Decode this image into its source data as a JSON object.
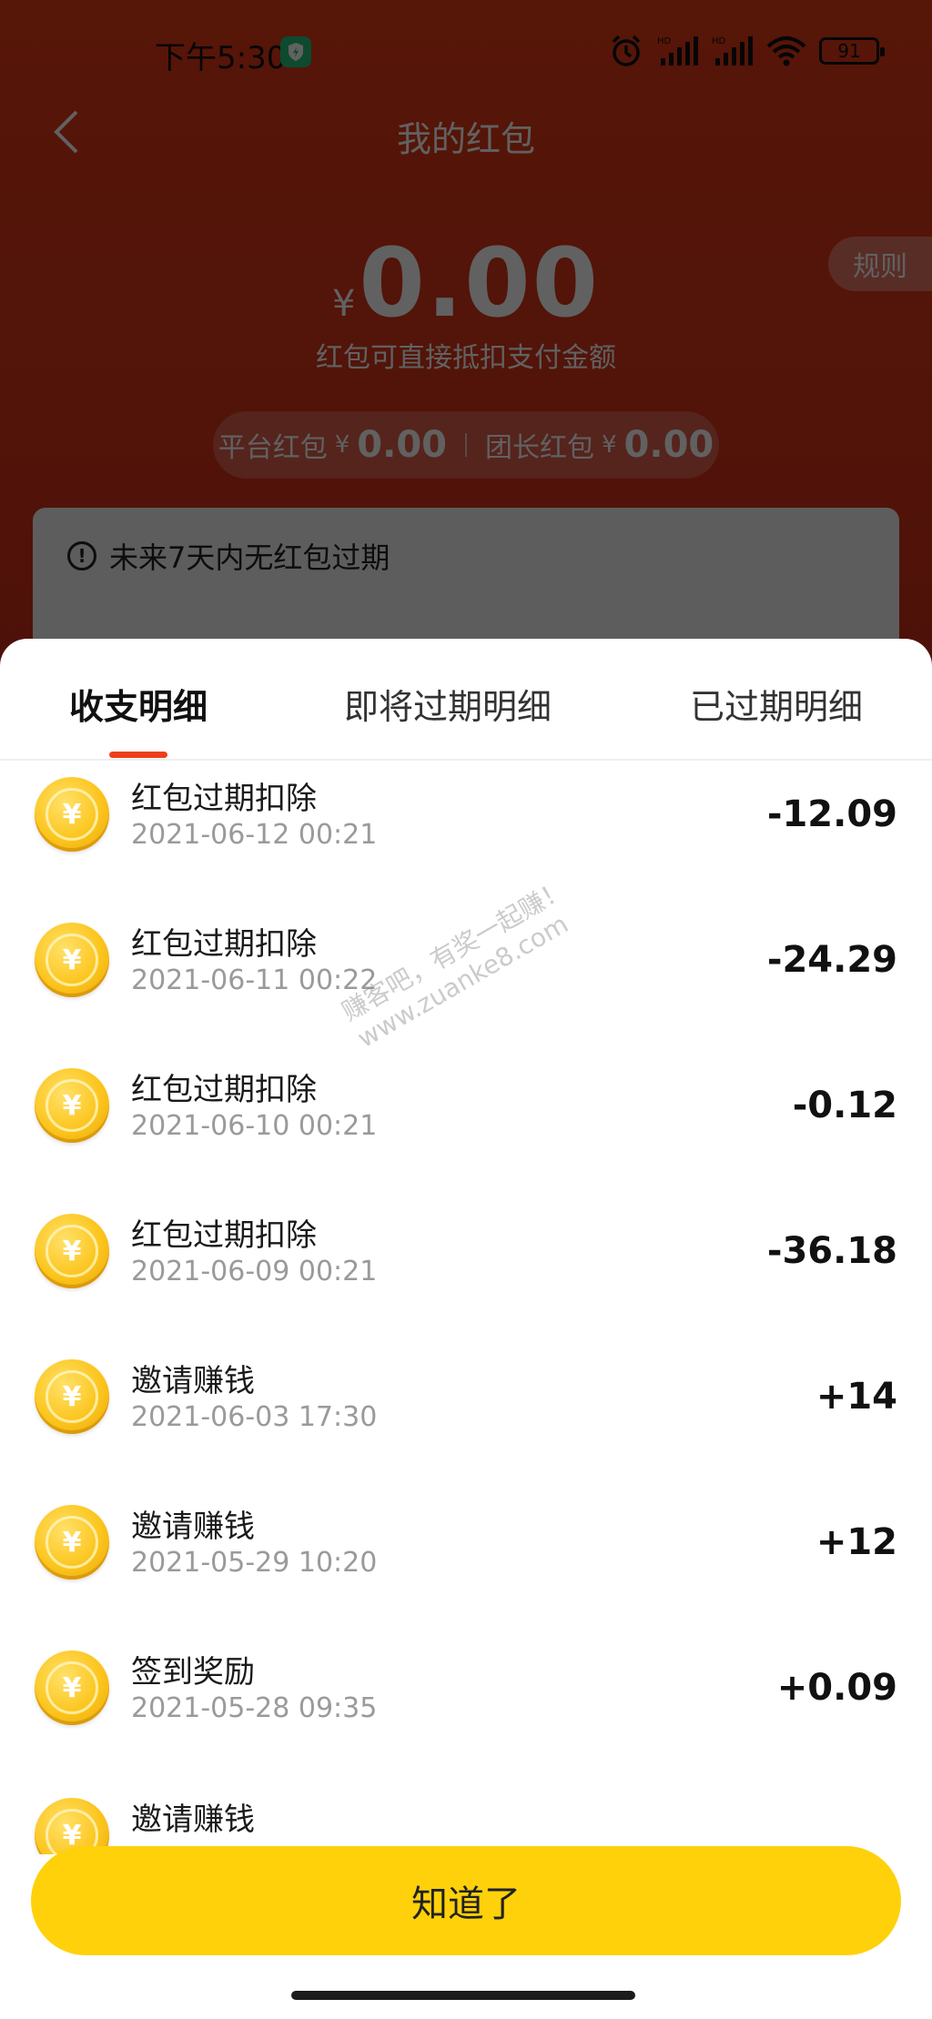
{
  "status_bar": {
    "time": "下午5:30",
    "battery": "91"
  },
  "header": {
    "title": "我的红包",
    "rules_label": "规则"
  },
  "balance": {
    "currency": "¥",
    "amount": "0.00",
    "subtitle": "红包可直接抵扣支付金额",
    "platform_label": "平台红包",
    "platform_currency": "¥",
    "platform_value": "0.00",
    "leader_label": "团长红包",
    "leader_currency": "¥",
    "leader_value": "0.00"
  },
  "notice": {
    "text": "未来7天内无红包过期"
  },
  "tabs": [
    {
      "label": "收支明细",
      "active": true
    },
    {
      "label": "即将过期明细",
      "active": false
    },
    {
      "label": "已过期明细",
      "active": false
    }
  ],
  "transactions": [
    {
      "title": "红包过期扣除",
      "date": "2021-06-12 00:21",
      "amount": "-12.09"
    },
    {
      "title": "红包过期扣除",
      "date": "2021-06-11 00:22",
      "amount": "-24.29"
    },
    {
      "title": "红包过期扣除",
      "date": "2021-06-10 00:21",
      "amount": "-0.12"
    },
    {
      "title": "红包过期扣除",
      "date": "2021-06-09 00:21",
      "amount": "-36.18"
    },
    {
      "title": "邀请赚钱",
      "date": "2021-06-03 17:30",
      "amount": "+14"
    },
    {
      "title": "邀请赚钱",
      "date": "2021-05-29 10:20",
      "amount": "+12"
    },
    {
      "title": "签到奖励",
      "date": "2021-05-28 09:35",
      "amount": "+0.09"
    },
    {
      "title": "邀请赚钱",
      "date": "",
      "amount": ""
    }
  ],
  "coin_symbol": "¥",
  "watermark": {
    "line1": "赚客吧，有奖一起赚！",
    "line2": "www.zuanke8.com"
  },
  "confirm_label": "知道了",
  "colors": {
    "brand_red": "#e23a16",
    "tab_indicator": "#ee3f1c",
    "confirm_yellow": "#ffd10a"
  }
}
